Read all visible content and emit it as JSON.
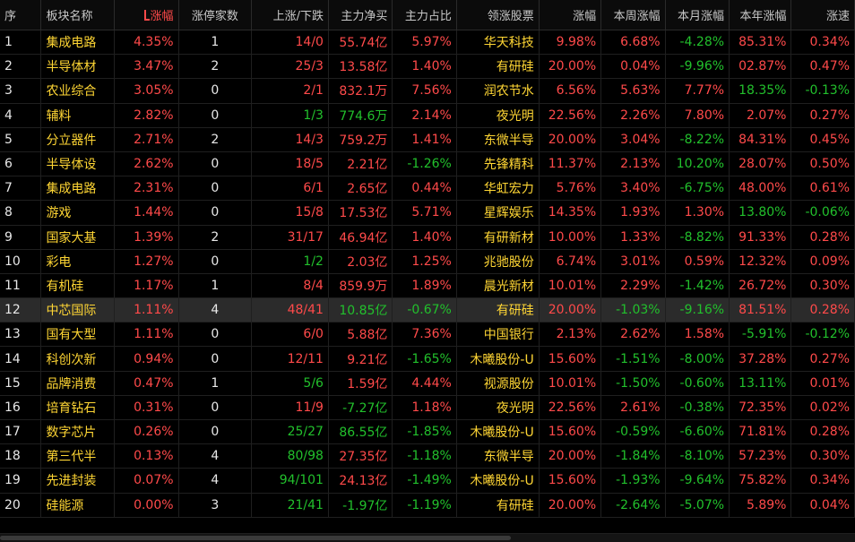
{
  "headers": {
    "idx": "序",
    "name": "板块名称",
    "pct": "涨幅",
    "limit_up": "涨停家数",
    "up_down": "上涨/下跌",
    "net_flow": "主力净买",
    "flow_ratio": "主力占比",
    "lead_stock": "领涨股票",
    "lead_pct": "涨幅",
    "week_pct": "本周涨幅",
    "month_pct": "本月涨幅",
    "year_pct": "本年涨幅",
    "speed": "涨速"
  },
  "colors": {
    "up": "#ff4a4a",
    "down": "#22c02c",
    "name": "#ffd634",
    "background": "#000000",
    "selected_row": "#2b2b2b"
  },
  "sort": {
    "column": "pct",
    "direction": "desc",
    "icon": "sort-desc-icon"
  },
  "selected_row": 11,
  "rows": [
    {
      "idx": "1",
      "name": "集成电路",
      "pct": "4.35%",
      "pct_dir": "up",
      "limit_up": "1",
      "up_down": "14/0",
      "up_down_dir": "up",
      "net_flow": "55.74亿",
      "net_flow_dir": "up",
      "flow_ratio": "5.97%",
      "flow_ratio_dir": "up",
      "lead_stock": "华天科技",
      "lead_pct": "9.98%",
      "lead_pct_dir": "up",
      "week_pct": "6.68%",
      "week_pct_dir": "up",
      "month_pct": "-4.28%",
      "month_pct_dir": "down",
      "year_pct": "85.31%",
      "year_pct_dir": "up",
      "speed": "0.34%",
      "speed_dir": "up"
    },
    {
      "idx": "2",
      "name": "半导体材",
      "pct": "3.47%",
      "pct_dir": "up",
      "limit_up": "2",
      "up_down": "25/3",
      "up_down_dir": "up",
      "net_flow": "13.58亿",
      "net_flow_dir": "up",
      "flow_ratio": "1.40%",
      "flow_ratio_dir": "up",
      "lead_stock": "有研硅",
      "lead_pct": "20.00%",
      "lead_pct_dir": "up",
      "week_pct": "0.04%",
      "week_pct_dir": "up",
      "month_pct": "-9.96%",
      "month_pct_dir": "down",
      "year_pct": "02.87%",
      "year_pct_dir": "up",
      "speed": "0.47%",
      "speed_dir": "up"
    },
    {
      "idx": "3",
      "name": "农业综合",
      "pct": "3.05%",
      "pct_dir": "up",
      "limit_up": "0",
      "up_down": "2/1",
      "up_down_dir": "up",
      "net_flow": "832.1万",
      "net_flow_dir": "up",
      "flow_ratio": "7.56%",
      "flow_ratio_dir": "up",
      "lead_stock": "润农节水",
      "lead_pct": "6.56%",
      "lead_pct_dir": "up",
      "week_pct": "5.63%",
      "week_pct_dir": "up",
      "month_pct": "7.77%",
      "month_pct_dir": "up",
      "year_pct": "18.35%",
      "year_pct_dir": "down",
      "speed": "-0.13%",
      "speed_dir": "down"
    },
    {
      "idx": "4",
      "name": "辅料",
      "pct": "2.82%",
      "pct_dir": "up",
      "limit_up": "0",
      "up_down": "1/3",
      "up_down_dir": "down",
      "net_flow": "774.6万",
      "net_flow_dir": "down",
      "flow_ratio": "2.14%",
      "flow_ratio_dir": "up",
      "lead_stock": "夜光明",
      "lead_pct": "22.56%",
      "lead_pct_dir": "up",
      "week_pct": "2.26%",
      "week_pct_dir": "up",
      "month_pct": "7.80%",
      "month_pct_dir": "up",
      "year_pct": "2.07%",
      "year_pct_dir": "up",
      "speed": "0.27%",
      "speed_dir": "up"
    },
    {
      "idx": "5",
      "name": "分立器件",
      "pct": "2.71%",
      "pct_dir": "up",
      "limit_up": "2",
      "up_down": "14/3",
      "up_down_dir": "up",
      "net_flow": "759.2万",
      "net_flow_dir": "up",
      "flow_ratio": "1.41%",
      "flow_ratio_dir": "up",
      "lead_stock": "东微半导",
      "lead_pct": "20.00%",
      "lead_pct_dir": "up",
      "week_pct": "3.04%",
      "week_pct_dir": "up",
      "month_pct": "-8.22%",
      "month_pct_dir": "down",
      "year_pct": "84.31%",
      "year_pct_dir": "up",
      "speed": "0.45%",
      "speed_dir": "up"
    },
    {
      "idx": "6",
      "name": "半导体设",
      "pct": "2.62%",
      "pct_dir": "up",
      "limit_up": "0",
      "up_down": "18/5",
      "up_down_dir": "up",
      "net_flow": "2.21亿",
      "net_flow_dir": "up",
      "flow_ratio": "-1.26%",
      "flow_ratio_dir": "down",
      "lead_stock": "先锋精科",
      "lead_pct": "11.37%",
      "lead_pct_dir": "up",
      "week_pct": "2.13%",
      "week_pct_dir": "up",
      "month_pct": "10.20%",
      "month_pct_dir": "down",
      "year_pct": "28.07%",
      "year_pct_dir": "up",
      "speed": "0.50%",
      "speed_dir": "up"
    },
    {
      "idx": "7",
      "name": "集成电路",
      "pct": "2.31%",
      "pct_dir": "up",
      "limit_up": "0",
      "up_down": "6/1",
      "up_down_dir": "up",
      "net_flow": "2.65亿",
      "net_flow_dir": "up",
      "flow_ratio": "0.44%",
      "flow_ratio_dir": "up",
      "lead_stock": "华虹宏力",
      "lead_pct": "5.76%",
      "lead_pct_dir": "up",
      "week_pct": "3.40%",
      "week_pct_dir": "up",
      "month_pct": "-6.75%",
      "month_pct_dir": "down",
      "year_pct": "48.00%",
      "year_pct_dir": "up",
      "speed": "0.61%",
      "speed_dir": "up"
    },
    {
      "idx": "8",
      "name": "游戏",
      "pct": "1.44%",
      "pct_dir": "up",
      "limit_up": "0",
      "up_down": "15/8",
      "up_down_dir": "up",
      "net_flow": "17.53亿",
      "net_flow_dir": "up",
      "flow_ratio": "5.71%",
      "flow_ratio_dir": "up",
      "lead_stock": "星辉娱乐",
      "lead_pct": "14.35%",
      "lead_pct_dir": "up",
      "week_pct": "1.93%",
      "week_pct_dir": "up",
      "month_pct": "1.30%",
      "month_pct_dir": "up",
      "year_pct": "13.80%",
      "year_pct_dir": "down",
      "speed": "-0.06%",
      "speed_dir": "down"
    },
    {
      "idx": "9",
      "name": "国家大基",
      "pct": "1.39%",
      "pct_dir": "up",
      "limit_up": "2",
      "up_down": "31/17",
      "up_down_dir": "up",
      "net_flow": "46.94亿",
      "net_flow_dir": "up",
      "flow_ratio": "1.40%",
      "flow_ratio_dir": "up",
      "lead_stock": "有研新材",
      "lead_pct": "10.00%",
      "lead_pct_dir": "up",
      "week_pct": "1.33%",
      "week_pct_dir": "up",
      "month_pct": "-8.82%",
      "month_pct_dir": "down",
      "year_pct": "91.33%",
      "year_pct_dir": "up",
      "speed": "0.28%",
      "speed_dir": "up"
    },
    {
      "idx": "10",
      "name": "彩电",
      "pct": "1.27%",
      "pct_dir": "up",
      "limit_up": "0",
      "up_down": "1/2",
      "up_down_dir": "down",
      "net_flow": "2.03亿",
      "net_flow_dir": "up",
      "flow_ratio": "1.25%",
      "flow_ratio_dir": "up",
      "lead_stock": "兆驰股份",
      "lead_pct": "6.74%",
      "lead_pct_dir": "up",
      "week_pct": "3.01%",
      "week_pct_dir": "up",
      "month_pct": "0.59%",
      "month_pct_dir": "up",
      "year_pct": "12.32%",
      "year_pct_dir": "up",
      "speed": "0.09%",
      "speed_dir": "up"
    },
    {
      "idx": "11",
      "name": "有机硅",
      "pct": "1.17%",
      "pct_dir": "up",
      "limit_up": "1",
      "up_down": "8/4",
      "up_down_dir": "up",
      "net_flow": "859.9万",
      "net_flow_dir": "up",
      "flow_ratio": "1.89%",
      "flow_ratio_dir": "up",
      "lead_stock": "晨光新材",
      "lead_pct": "10.01%",
      "lead_pct_dir": "up",
      "week_pct": "2.29%",
      "week_pct_dir": "up",
      "month_pct": "-1.42%",
      "month_pct_dir": "down",
      "year_pct": "26.72%",
      "year_pct_dir": "up",
      "speed": "0.30%",
      "speed_dir": "up"
    },
    {
      "idx": "12",
      "name": "中芯国际",
      "pct": "1.11%",
      "pct_dir": "up",
      "limit_up": "4",
      "up_down": "48/41",
      "up_down_dir": "up",
      "net_flow": "10.85亿",
      "net_flow_dir": "down",
      "flow_ratio": "-0.67%",
      "flow_ratio_dir": "down",
      "lead_stock": "有研硅",
      "lead_pct": "20.00%",
      "lead_pct_dir": "up",
      "week_pct": "-1.03%",
      "week_pct_dir": "down",
      "month_pct": "-9.16%",
      "month_pct_dir": "down",
      "year_pct": "81.51%",
      "year_pct_dir": "up",
      "speed": "0.28%",
      "speed_dir": "up"
    },
    {
      "idx": "13",
      "name": "国有大型",
      "pct": "1.11%",
      "pct_dir": "up",
      "limit_up": "0",
      "up_down": "6/0",
      "up_down_dir": "up",
      "net_flow": "5.88亿",
      "net_flow_dir": "up",
      "flow_ratio": "7.36%",
      "flow_ratio_dir": "up",
      "lead_stock": "中国银行",
      "lead_pct": "2.13%",
      "lead_pct_dir": "up",
      "week_pct": "2.62%",
      "week_pct_dir": "up",
      "month_pct": "1.58%",
      "month_pct_dir": "up",
      "year_pct": "-5.91%",
      "year_pct_dir": "down",
      "speed": "-0.12%",
      "speed_dir": "down"
    },
    {
      "idx": "14",
      "name": "科创次新",
      "pct": "0.94%",
      "pct_dir": "up",
      "limit_up": "0",
      "up_down": "12/11",
      "up_down_dir": "up",
      "net_flow": "9.21亿",
      "net_flow_dir": "up",
      "flow_ratio": "-1.65%",
      "flow_ratio_dir": "down",
      "lead_stock": "木曦股份-U",
      "lead_pct": "15.60%",
      "lead_pct_dir": "up",
      "week_pct": "-1.51%",
      "week_pct_dir": "down",
      "month_pct": "-8.00%",
      "month_pct_dir": "down",
      "year_pct": "37.28%",
      "year_pct_dir": "up",
      "speed": "0.27%",
      "speed_dir": "up"
    },
    {
      "idx": "15",
      "name": "品牌消费",
      "pct": "0.47%",
      "pct_dir": "up",
      "limit_up": "1",
      "up_down": "5/6",
      "up_down_dir": "down",
      "net_flow": "1.59亿",
      "net_flow_dir": "up",
      "flow_ratio": "4.44%",
      "flow_ratio_dir": "up",
      "lead_stock": "视源股份",
      "lead_pct": "10.01%",
      "lead_pct_dir": "up",
      "week_pct": "-1.50%",
      "week_pct_dir": "down",
      "month_pct": "-0.60%",
      "month_pct_dir": "down",
      "year_pct": "13.11%",
      "year_pct_dir": "down",
      "speed": "0.01%",
      "speed_dir": "up"
    },
    {
      "idx": "16",
      "name": "培育钻石",
      "pct": "0.31%",
      "pct_dir": "up",
      "limit_up": "0",
      "up_down": "11/9",
      "up_down_dir": "up",
      "net_flow": "-7.27亿",
      "net_flow_dir": "down",
      "flow_ratio": "1.18%",
      "flow_ratio_dir": "up",
      "lead_stock": "夜光明",
      "lead_pct": "22.56%",
      "lead_pct_dir": "up",
      "week_pct": "2.61%",
      "week_pct_dir": "up",
      "month_pct": "-0.38%",
      "month_pct_dir": "down",
      "year_pct": "72.35%",
      "year_pct_dir": "up",
      "speed": "0.02%",
      "speed_dir": "up"
    },
    {
      "idx": "17",
      "name": "数字芯片",
      "pct": "0.26%",
      "pct_dir": "up",
      "limit_up": "0",
      "up_down": "25/27",
      "up_down_dir": "down",
      "net_flow": "86.55亿",
      "net_flow_dir": "down",
      "flow_ratio": "-1.85%",
      "flow_ratio_dir": "down",
      "lead_stock": "木曦股份-U",
      "lead_pct": "15.60%",
      "lead_pct_dir": "up",
      "week_pct": "-0.59%",
      "week_pct_dir": "down",
      "month_pct": "-6.60%",
      "month_pct_dir": "down",
      "year_pct": "71.81%",
      "year_pct_dir": "up",
      "speed": "0.28%",
      "speed_dir": "up"
    },
    {
      "idx": "18",
      "name": "第三代半",
      "pct": "0.13%",
      "pct_dir": "up",
      "limit_up": "4",
      "up_down": "80/98",
      "up_down_dir": "down",
      "net_flow": "27.35亿",
      "net_flow_dir": "up",
      "flow_ratio": "-1.18%",
      "flow_ratio_dir": "down",
      "lead_stock": "东微半导",
      "lead_pct": "20.00%",
      "lead_pct_dir": "up",
      "week_pct": "-1.84%",
      "week_pct_dir": "down",
      "month_pct": "-8.10%",
      "month_pct_dir": "down",
      "year_pct": "57.23%",
      "year_pct_dir": "up",
      "speed": "0.30%",
      "speed_dir": "up"
    },
    {
      "idx": "19",
      "name": "先进封装",
      "pct": "0.07%",
      "pct_dir": "up",
      "limit_up": "4",
      "up_down": "94/101",
      "up_down_dir": "down",
      "net_flow": "24.13亿",
      "net_flow_dir": "up",
      "flow_ratio": "-1.49%",
      "flow_ratio_dir": "down",
      "lead_stock": "木曦股份-U",
      "lead_pct": "15.60%",
      "lead_pct_dir": "up",
      "week_pct": "-1.93%",
      "week_pct_dir": "down",
      "month_pct": "-9.64%",
      "month_pct_dir": "down",
      "year_pct": "75.82%",
      "year_pct_dir": "up",
      "speed": "0.34%",
      "speed_dir": "up"
    },
    {
      "idx": "20",
      "name": "硅能源",
      "pct": "0.00%",
      "pct_dir": "up",
      "limit_up": "3",
      "up_down": "21/41",
      "up_down_dir": "down",
      "net_flow": "-1.97亿",
      "net_flow_dir": "down",
      "flow_ratio": "-1.19%",
      "flow_ratio_dir": "down",
      "lead_stock": "有研硅",
      "lead_pct": "20.00%",
      "lead_pct_dir": "up",
      "week_pct": "-2.64%",
      "week_pct_dir": "down",
      "month_pct": "-5.07%",
      "month_pct_dir": "down",
      "year_pct": "5.89%",
      "year_pct_dir": "up",
      "speed": "0.04%",
      "speed_dir": "up"
    }
  ]
}
